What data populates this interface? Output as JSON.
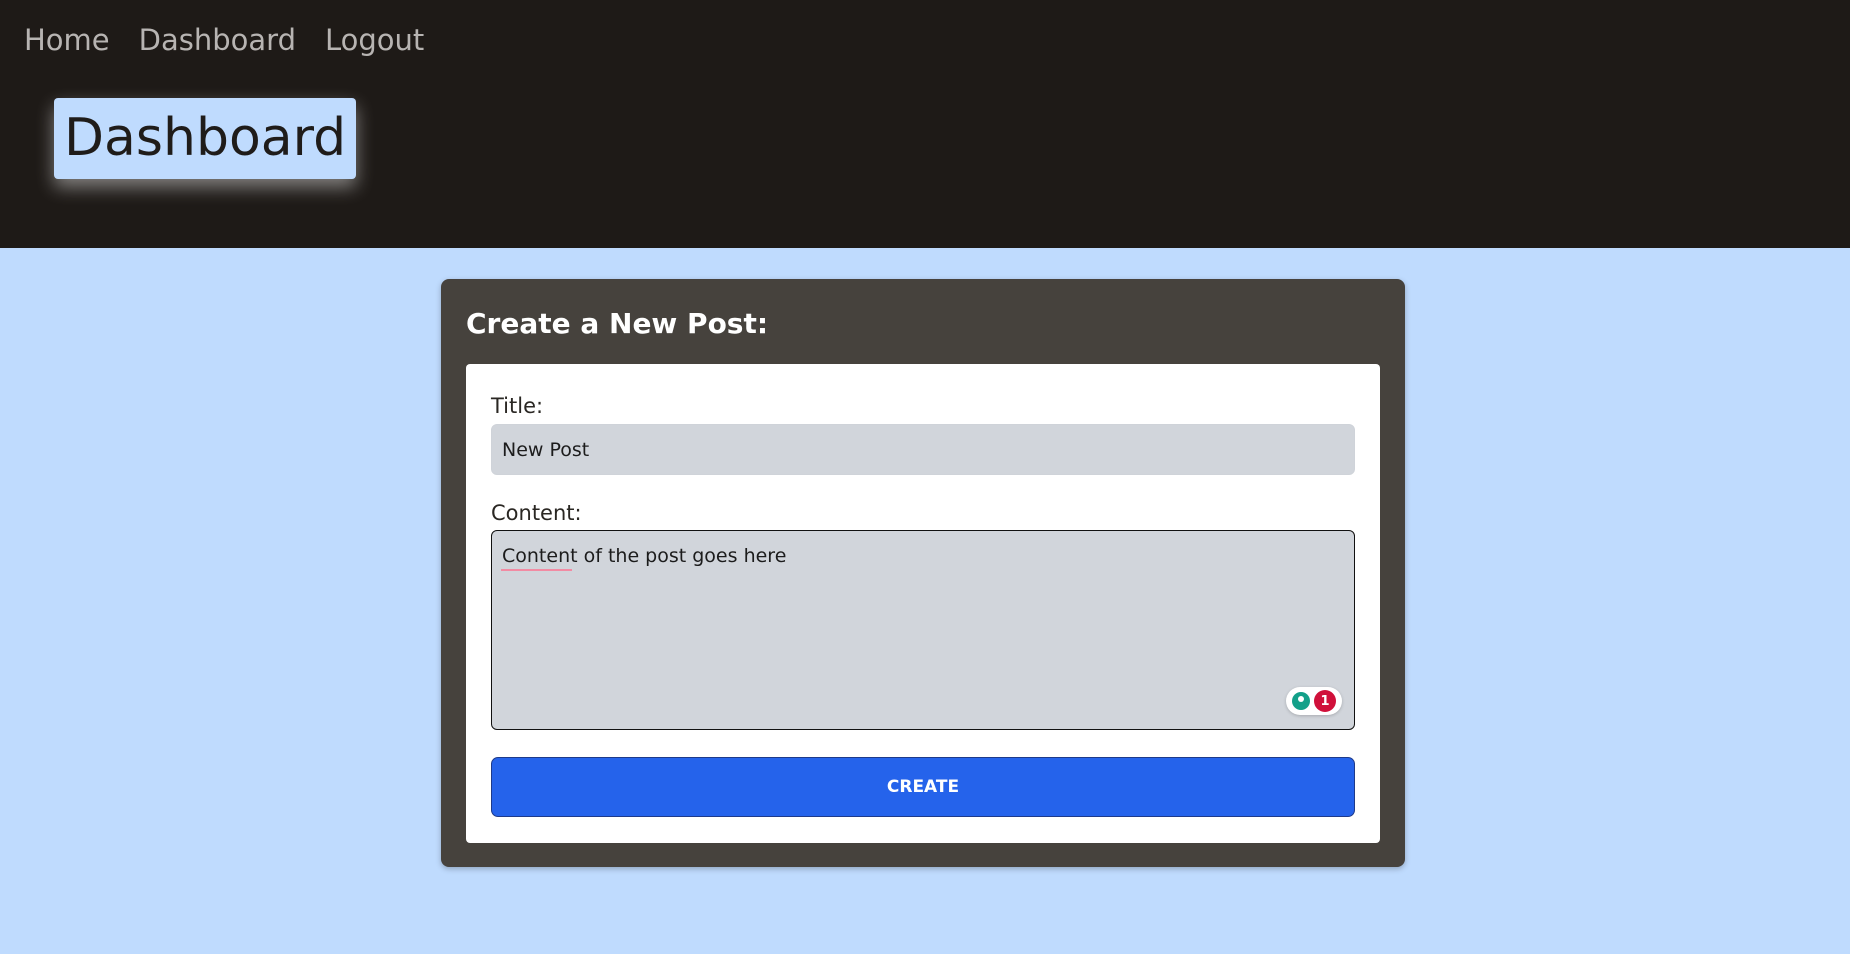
{
  "nav": {
    "items": [
      {
        "label": "Home"
      },
      {
        "label": "Dashboard"
      },
      {
        "label": "Logout"
      }
    ]
  },
  "header": {
    "title": "Dashboard"
  },
  "form": {
    "heading": "Create a New Post:",
    "title_label": "Title:",
    "title_value": "New Post",
    "content_label": "Content:",
    "content_value": "Content of the post goes here",
    "grammar_badge_count": "1",
    "submit_label": "CREATE"
  },
  "colors": {
    "header_bg": "#1e1a17",
    "page_bg": "#bfdbfe",
    "card_bg": "#46423d",
    "button_bg": "#2563eb",
    "input_bg": "#d1d5db"
  },
  "icons": {
    "grammar_assistant": "lightbulb-icon"
  }
}
